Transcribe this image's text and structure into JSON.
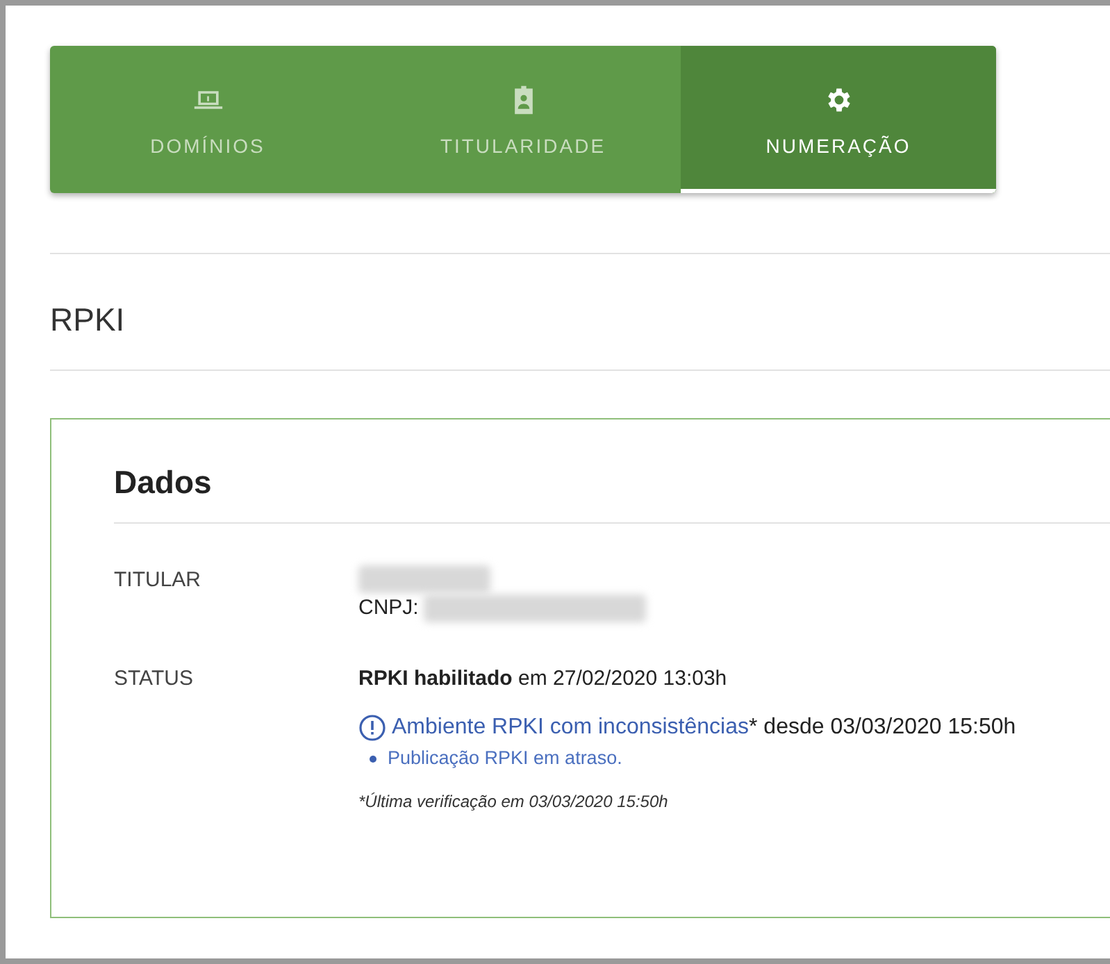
{
  "tabs": [
    {
      "label": "DOMÍNIOS",
      "kind": "laptop",
      "selected": false
    },
    {
      "label": "TITULARIDADE",
      "kind": "badge",
      "selected": false
    },
    {
      "label": "NUMERAÇÃO",
      "kind": "gear",
      "selected": true
    }
  ],
  "page_title": "RPKI",
  "card": {
    "title": "Dados",
    "rows": [
      {
        "label": "TITULAR",
        "kind": "holder",
        "name_redacted": true,
        "cnpj_label": "CNPJ:",
        "cnpj_redacted": true
      },
      {
        "label": "STATUS",
        "kind": "status",
        "enabled_text": "RPKI habilitado",
        "enabled_date": "em 27/02/2020 13:03h",
        "alert_link": "Ambiente RPKI com inconsistências",
        "alert_suffix": "* desde 03/03/2020 15:50h",
        "issues": [
          "Publicação RPKI em atraso."
        ],
        "footnote": "*Última verificação em 03/03/2020 15:50h"
      }
    ]
  }
}
